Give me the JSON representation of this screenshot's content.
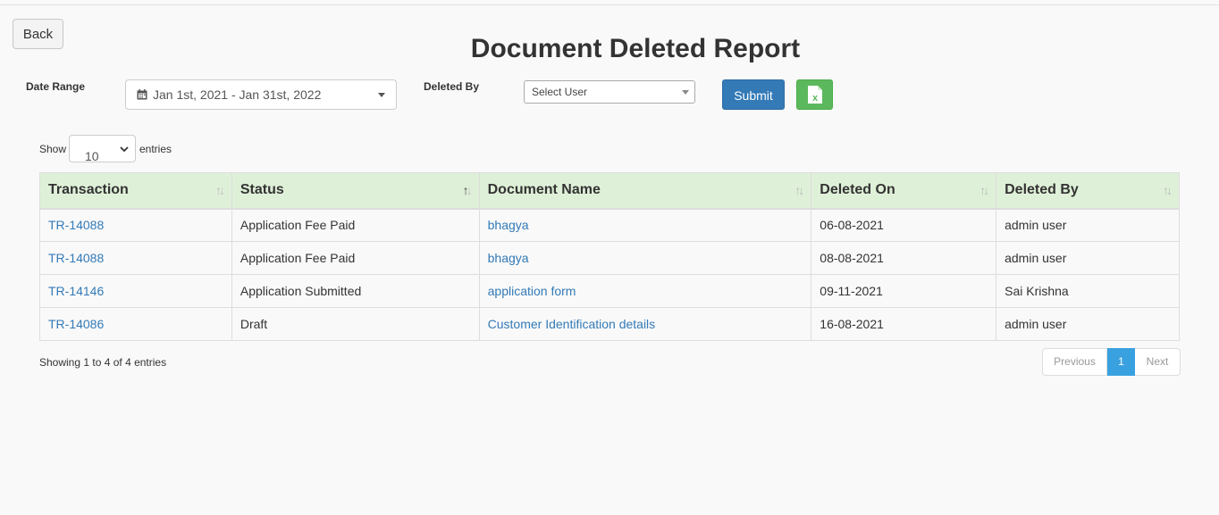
{
  "header": {
    "back_label": "Back",
    "title": "Document Deleted Report"
  },
  "filters": {
    "date_range_label": "Date Range",
    "date_range_value": "Jan 1st, 2021 - Jan 31st, 2022",
    "deleted_by_label": "Deleted By",
    "deleted_by_value": "Select User",
    "submit_label": "Submit",
    "excel_icon": "excel-export-icon"
  },
  "length_menu": {
    "show_label": "Show",
    "value": "10",
    "entries_label": "entries"
  },
  "table": {
    "columns": [
      "Transaction",
      "Status",
      "Document Name",
      "Deleted On",
      "Deleted By"
    ],
    "rows": [
      {
        "transaction": "TR-14088",
        "status": "Application Fee Paid",
        "document": "bhagya",
        "deleted_on": "06-08-2021",
        "deleted_by": "admin user"
      },
      {
        "transaction": "TR-14088",
        "status": "Application Fee Paid",
        "document": "bhagya",
        "deleted_on": "08-08-2021",
        "deleted_by": "admin user"
      },
      {
        "transaction": "TR-14146",
        "status": "Application Submitted",
        "document": "application form",
        "deleted_on": "09-11-2021",
        "deleted_by": "Sai Krishna"
      },
      {
        "transaction": "TR-14086",
        "status": "Draft",
        "document": "Customer Identification details",
        "deleted_on": "16-08-2021",
        "deleted_by": "admin user"
      }
    ]
  },
  "footer": {
    "info": "Showing 1 to 4 of 4 entries",
    "previous_label": "Previous",
    "current_page": "1",
    "next_label": "Next"
  },
  "colors": {
    "header_bg": "#dff0d8",
    "link": "#337ab7",
    "submit": "#337ab7",
    "excel": "#5cb85c",
    "active_page": "#3aa1e0"
  }
}
